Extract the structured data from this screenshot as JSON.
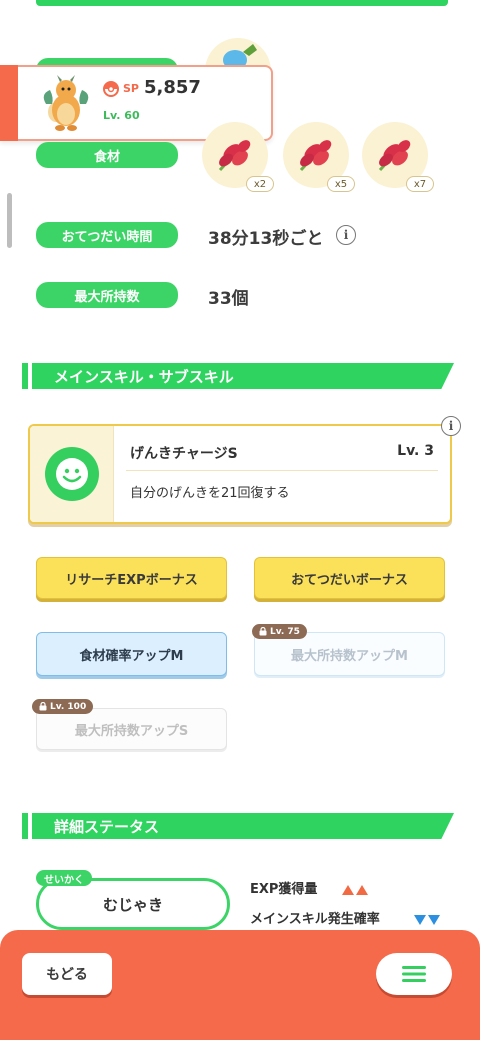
{
  "pokemon_card": {
    "sp_label": "SP",
    "sp_value": "5,857",
    "level": "Lv. 60",
    "icon": "dragonite-icon"
  },
  "stats": {
    "ingredients_label": "食材",
    "ingredients": [
      {
        "icon": "fancy-apple-icon",
        "count": "x2"
      },
      {
        "icon": "fancy-apple-icon",
        "count": "x5"
      },
      {
        "icon": "fancy-apple-icon",
        "count": "x7"
      }
    ],
    "help_time_label": "おてつだい時間",
    "help_time_value": "38分13秒ごと",
    "max_carry_label": "最大所持数",
    "max_carry_value": "33個",
    "info_glyph": "i"
  },
  "main_skill_section": {
    "title": "メインスキル・サブスキル",
    "skill_name": "げんきチャージS",
    "skill_level": "Lv. 3",
    "skill_desc": "自分のげんきを21回復する",
    "info_glyph": "i"
  },
  "sub_skills": [
    {
      "label": "リサーチEXPボーナス",
      "state": "unlocked-gold"
    },
    {
      "label": "おてつだいボーナス",
      "state": "unlocked-gold"
    },
    {
      "label": "食材確率アップM",
      "state": "unlocked-blue"
    },
    {
      "label": "最大所持数アップM",
      "state": "locked",
      "lock_level": "Lv. 75"
    },
    {
      "label": "最大所持数アップS",
      "state": "locked",
      "lock_level": "Lv. 100"
    }
  ],
  "detail_section": {
    "title": "詳細ステータス",
    "nature_tag": "せいかく",
    "nature_value": "むじゃき",
    "effects": [
      {
        "label": "EXP獲得量",
        "direction": "up",
        "color": "#f26a43"
      },
      {
        "label": "メインスキル発生確率",
        "direction": "down",
        "color": "#2d8fe0"
      }
    ]
  },
  "bottom_nav": {
    "back_label": "もどる",
    "menu_icon": "hamburger-menu-icon"
  },
  "colors": {
    "accent_green": "#2fd35f",
    "bottom_bar": "#f46a4b",
    "gold_button": "#fbe15a",
    "blue_button": "#dcefff"
  }
}
